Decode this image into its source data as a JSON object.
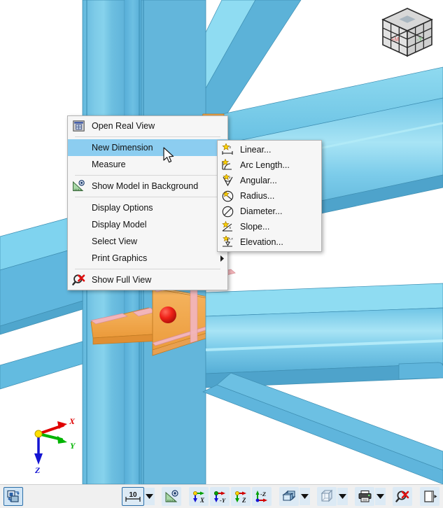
{
  "app": {
    "view_type": "3d-structural-model",
    "background": "#ffffff"
  },
  "context_menu": {
    "name": "view-context-menu",
    "items": [
      {
        "id": "open-real-view",
        "label": "Open Real View",
        "icon": "real-view-icon",
        "submenu": false,
        "separator_after": true,
        "selected": false
      },
      {
        "id": "new-dimension",
        "label": "New Dimension",
        "icon": "none",
        "submenu": true,
        "separator_after": false,
        "selected": true
      },
      {
        "id": "measure",
        "label": "Measure",
        "icon": "none",
        "submenu": true,
        "separator_after": true,
        "selected": false
      },
      {
        "id": "show-model-in-background",
        "label": "Show Model in Background",
        "icon": "ruler-eye-icon",
        "submenu": false,
        "separator_after": true,
        "selected": false
      },
      {
        "id": "display-options",
        "label": "Display Options",
        "icon": "none",
        "submenu": true,
        "separator_after": false,
        "selected": false
      },
      {
        "id": "display-model",
        "label": "Display Model",
        "icon": "none",
        "submenu": true,
        "separator_after": false,
        "selected": false
      },
      {
        "id": "select-view",
        "label": "Select View",
        "icon": "none",
        "submenu": true,
        "separator_after": false,
        "selected": false
      },
      {
        "id": "print-graphics",
        "label": "Print Graphics",
        "icon": "none",
        "submenu": true,
        "separator_after": true,
        "selected": false
      },
      {
        "id": "show-full-view",
        "label": "Show Full View",
        "icon": "zoom-reset-icon",
        "submenu": false,
        "separator_after": false,
        "selected": false
      }
    ]
  },
  "submenu": {
    "name": "new-dimension-submenu",
    "parent": "New Dimension",
    "items": [
      {
        "id": "linear",
        "label": "Linear...",
        "icon": "dimension-linear-icon"
      },
      {
        "id": "arc-length",
        "label": "Arc Length...",
        "icon": "dimension-arc-length-icon"
      },
      {
        "id": "angular",
        "label": "Angular...",
        "icon": "dimension-angular-icon"
      },
      {
        "id": "radius",
        "label": "Radius...",
        "icon": "dimension-radius-icon"
      },
      {
        "id": "diameter",
        "label": "Diameter...",
        "icon": "dimension-diameter-icon"
      },
      {
        "id": "slope",
        "label": "Slope...",
        "icon": "dimension-slope-icon"
      },
      {
        "id": "elevation",
        "label": "Elevation...",
        "icon": "dimension-elevation-icon"
      }
    ]
  },
  "axis_triad": {
    "name": "axis-orientation-indicator",
    "axes": [
      {
        "label": "X",
        "color": "#e00000"
      },
      {
        "label": "Y",
        "color": "#00b400"
      },
      {
        "label": "Z",
        "color": "#1414d2"
      }
    ]
  },
  "nav_cube": {
    "name": "navigation-cube",
    "face_labels": [
      {
        "label": "+M",
        "color": "#e08888"
      },
      {
        "label": "-Y",
        "color": "#88cc88"
      }
    ]
  },
  "toolbar": {
    "name": "view-toolbar",
    "scale_value": "10",
    "buttons": [
      {
        "id": "toggle-render",
        "icon": "render-toggle-icon",
        "label": "",
        "active": true,
        "caret": false
      },
      {
        "id": "dimension-scale",
        "icon": "scale-value-icon",
        "label": "10",
        "active": true,
        "caret": true
      },
      {
        "id": "measure-tool",
        "icon": "ruler-eye-icon",
        "label": "",
        "active": false,
        "caret": false
      },
      {
        "id": "view-x",
        "icon": "axis-view-x-icon",
        "label": "X",
        "active": false,
        "caret": false
      },
      {
        "id": "view-minus-y",
        "icon": "axis-view-negy-icon",
        "label": "-Y",
        "active": false,
        "caret": false
      },
      {
        "id": "view-z",
        "icon": "axis-view-z-icon",
        "label": "Z",
        "active": false,
        "caret": false
      },
      {
        "id": "view-minus-z",
        "icon": "axis-view-negz-icon",
        "label": "-Z",
        "active": false,
        "caret": false
      },
      {
        "id": "render-mode",
        "icon": "solid-blocks-icon",
        "label": "",
        "active": false,
        "caret": true
      },
      {
        "id": "wireframe-mode",
        "icon": "wireframe-cube-icon",
        "label": "",
        "active": false,
        "caret": true
      },
      {
        "id": "print",
        "icon": "printer-icon",
        "label": "",
        "active": false,
        "caret": true
      },
      {
        "id": "zoom-reset",
        "icon": "zoom-reset-icon",
        "label": "",
        "active": false,
        "caret": false
      },
      {
        "id": "panel-toggle",
        "icon": "panel-toggle-icon",
        "label": "",
        "active": false,
        "caret": false
      }
    ]
  },
  "model": {
    "name": "steel-connection-model",
    "description": "3D structural steel beam-to-column connection",
    "colors": {
      "steel_blue": "#5bb4dc",
      "steel_blue_light": "#7fd4ee",
      "steel_blue_dark": "#4a9ec4",
      "gusset_orange": "#f0a64b",
      "plate_pink": "#f0b0b4",
      "node_red": "#e81010"
    }
  }
}
